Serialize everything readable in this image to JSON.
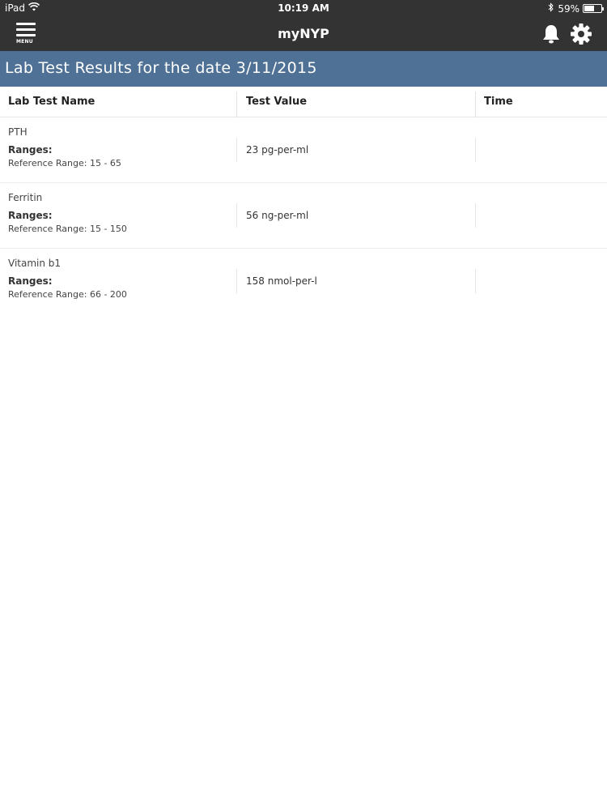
{
  "status_bar": {
    "device": "iPad",
    "time": "10:19 AM",
    "battery": "59%",
    "battery_level": 0.59
  },
  "nav": {
    "menu_label": "MENU",
    "title": "myNYP",
    "icons": [
      "menu-icon",
      "bell-icon",
      "gear-icon"
    ]
  },
  "header": {
    "title": "Lab Test Results for the date 3/11/2015"
  },
  "table": {
    "columns": [
      "Lab Test Name",
      "Test Value",
      "Time"
    ],
    "rows": [
      {
        "name": "PTH",
        "ranges_label": "Ranges:",
        "reference": "Reference Range: 15 - 65",
        "value": "23 pg-per-ml",
        "time": ""
      },
      {
        "name": "Ferritin",
        "ranges_label": "Ranges:",
        "reference": "Reference Range: 15 - 150",
        "value": "56 ng-per-ml",
        "time": ""
      },
      {
        "name": "Vitamin b1",
        "ranges_label": "Ranges:",
        "reference": "Reference Range: 66 - 200",
        "value": "158 nmol-per-l",
        "time": ""
      }
    ]
  },
  "colors": {
    "topbar": "#333333",
    "header": "#4f7196"
  }
}
